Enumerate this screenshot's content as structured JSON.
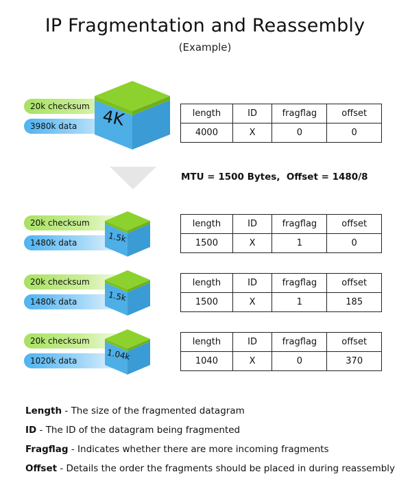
{
  "header": {
    "title": "IP Fragmentation and Reassembly",
    "subtitle": "(Example)"
  },
  "colors": {
    "checksum_green": "#a8e063",
    "data_blue": "#4fb3f0",
    "cube_top": "#8dd12f",
    "cube_front": "#4eaee6",
    "cube_side": "#3a9bd5",
    "arrow_gray": "#e6e6e6",
    "border": "#222222"
  },
  "table_headers": [
    "length",
    "ID",
    "fragflag",
    "offset"
  ],
  "original": {
    "checksum": "20k checksum",
    "data": "3980k data",
    "cube_label": "4K",
    "row": [
      "4000",
      "X",
      "0",
      "0"
    ]
  },
  "mtu_note": "MTU = 1500 Bytes,  Offset = 1480/8",
  "fragments": [
    {
      "checksum": "20k checksum",
      "data": "1480k data",
      "cube_label": "1.5k",
      "row": [
        "1500",
        "X",
        "1",
        "0"
      ]
    },
    {
      "checksum": "20k checksum",
      "data": "1480k data",
      "cube_label": "1.5k",
      "row": [
        "1500",
        "X",
        "1",
        "185"
      ]
    },
    {
      "checksum": "20k checksum",
      "data": "1020k data",
      "cube_label": "1.04k",
      "row": [
        "1040",
        "X",
        "0",
        "370"
      ]
    }
  ],
  "legend": [
    {
      "term": "Length",
      "desc": " - The size of the fragmented datagram"
    },
    {
      "term": "ID",
      "desc": " - The ID of the datagram being fragmented"
    },
    {
      "term": "Fragflag",
      "desc": " - Indicates whether there are more incoming fragments"
    },
    {
      "term": "Offset",
      "desc": " - Details the order the fragments should be placed in during reassembly"
    }
  ]
}
